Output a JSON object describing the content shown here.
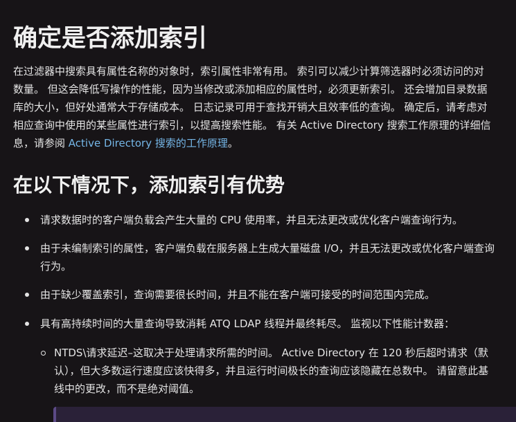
{
  "article": {
    "title": "确定是否添加索引",
    "intro": {
      "lines": [
        "在过滤器中搜索具有属性名称的对象时，索引属性非常有用。 索引可以减少计算筛选器时必须访问的对",
        "数量。 但这会降低写操作的性能，因为当修改或添加相应的属性时，必须更新索引。 还会增加目录数据",
        "库的大小，但好处通常大于存储成本。 日志记录可用于查找开销大且效率低的查询。 确定后，请考虑对",
        "相应查询中使用的某些属性进行索引，以提高搜索性能。 有关 Active Directory 搜索工作原理的详细信"
      ],
      "last_line_prefix": "息，请参阅 ",
      "link_text": "Active Directory 搜索的工作原理",
      "last_line_suffix": "。"
    },
    "section_heading": "在以下情况下，添加索引有优势",
    "bullets": [
      {
        "lines": [
          "请求数据时的客户端负载会产生大量的 CPU 使用率，并且无法更改或优化客户端查询行为。"
        ]
      },
      {
        "lines": [
          "由于未编制索引的属性，客户端负载在服务器上生成大量磁盘 I/O，并且无法更改或优化客户端查询",
          "行为。"
        ]
      },
      {
        "lines": [
          "由于缺少覆盖索引，查询需要很长时间，并且不能在客户端可接受的时间范围内完成。"
        ]
      },
      {
        "lines": [
          "具有高持续时间的大量查询导致消耗 ATQ LDAP 线程并最终耗尽。 监视以下性能计数器："
        ]
      }
    ],
    "sub_bullets": [
      {
        "lines": [
          "NTDS\\请求延迟–这取决于处理请求所需的时间。 Active Directory 在 120 秒后超时请求（默",
          "认），但大多数运行速度应该快得多，并且运行时间极长的查询应该隐藏在总数中。 请留意此基",
          "线中的更改，而不是绝对阈值。"
        ]
      }
    ]
  }
}
